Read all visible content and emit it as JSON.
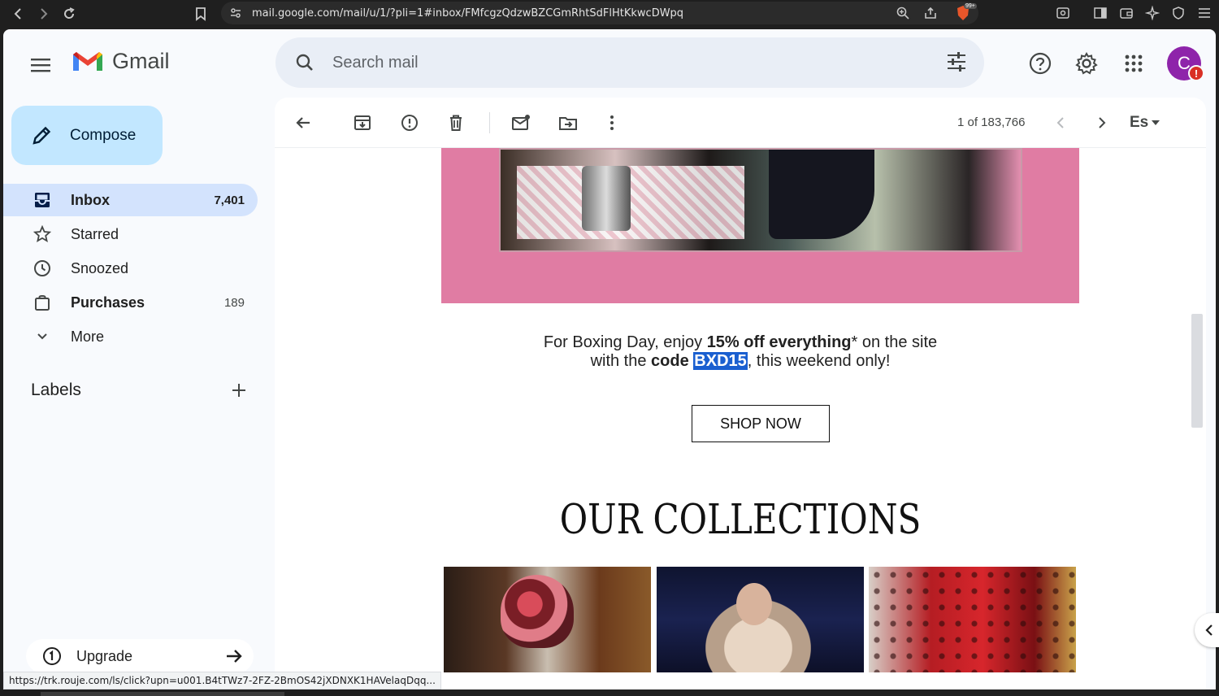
{
  "browser": {
    "url": "mail.google.com/mail/u/1/?pli=1#inbox/FMfcgzQdzwBZCGmRhtSdFlHtKkwcDWpq",
    "badge": "99+",
    "status_url": "https://trk.rouje.com/ls/click?upn=u001.B4tTWz7-2FZ-2BmOS42jXDNXK1HAVelaqDqq..."
  },
  "header": {
    "app_name": "Gmail",
    "search_placeholder": "Search mail",
    "avatar_initial": "C",
    "avatar_alert": "!"
  },
  "sidebar": {
    "compose_label": "Compose",
    "items": [
      {
        "label": "Inbox",
        "count": "7,401"
      },
      {
        "label": "Starred",
        "count": ""
      },
      {
        "label": "Snoozed",
        "count": ""
      },
      {
        "label": "Purchases",
        "count": "189"
      },
      {
        "label": "More",
        "count": ""
      }
    ],
    "labels_heading": "Labels",
    "upgrade_label": "Upgrade"
  },
  "toolbar": {
    "pager": "1 of 183,766",
    "input_tool": "Es"
  },
  "email": {
    "promo_line1_a": "For Boxing Day, enjoy ",
    "promo_line1_b": "15% off everything",
    "promo_line1_c": "* on the site",
    "promo_line2_a": "with the ",
    "promo_line2_b": "code ",
    "promo_code": "BXD15",
    "promo_line2_c": ", this weekend only!",
    "shop_button": "SHOP NOW",
    "collections_heading": "OUR COLLECTIONS"
  },
  "colors": {
    "compose_bg": "#c2e7ff",
    "active_nav": "#d3e3fd",
    "pink_banner": "#e07ca3",
    "code_highlight": "#1a5fd0",
    "avatar": "#8e24aa"
  }
}
